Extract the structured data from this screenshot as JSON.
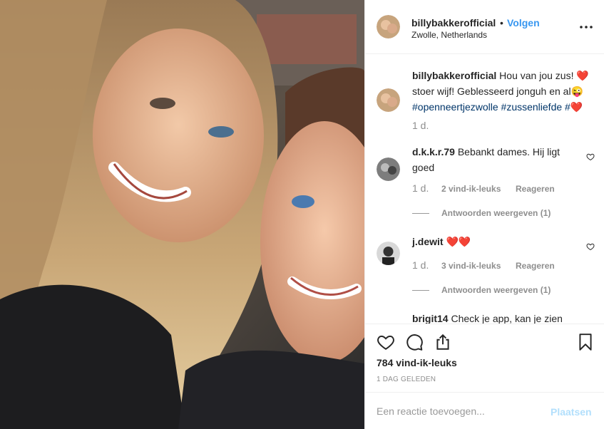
{
  "post": {
    "username": "billybakkerofficial",
    "dot": "•",
    "follow_label": "Volgen",
    "location": "Zwolle, Netherlands"
  },
  "caption": {
    "username": "billybakkerofficial",
    "text_1": "Hou van jou zus! ",
    "text_2": "stoer wijf! Geblesseerd jonguh en al",
    "hashtag_1": "#openneertjezwolle",
    "hashtag_2": "#zussenliefde",
    "hashtag_3": "#",
    "time": "1 d."
  },
  "comments": [
    {
      "username": "d.k.k.r.79",
      "text": "Bebankt dames. Hij ligt goed",
      "time": "1 d.",
      "likes": "2 vind-ik-leuks",
      "reply": "Reageren",
      "view_replies": "Antwoorden weergeven (1)"
    },
    {
      "username": "j.dewit",
      "text": "",
      "time": "1 d.",
      "likes": "3 vind-ik-leuks",
      "reply": "Reageren",
      "view_replies": "Antwoorden weergeven (1)"
    },
    {
      "username": "brigit14",
      "text": "Check je app, kan je zien"
    }
  ],
  "likes_count": "784 vind-ik-leuks",
  "date": "1 DAG GELEDEN",
  "add_comment": {
    "placeholder": "Een reactie toevoegen...",
    "post_label": "Plaatsen"
  },
  "colors": {
    "link_blue": "#3897f0",
    "hashtag": "#003569",
    "heart_red": "#ed4956",
    "post_disabled": "#b2dffc"
  }
}
